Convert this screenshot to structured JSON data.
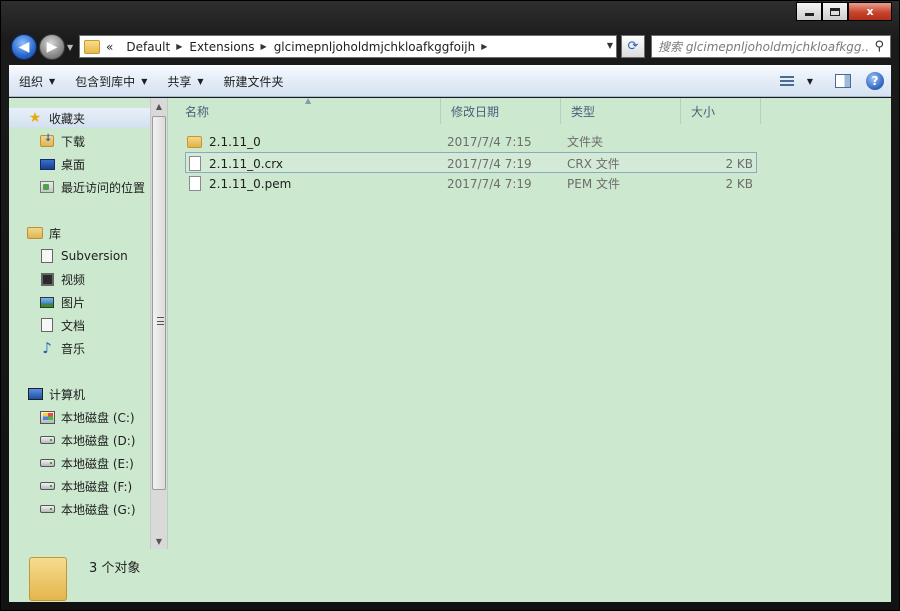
{
  "window": {
    "caption": {
      "minimize": "",
      "maximize": "",
      "close": "x"
    }
  },
  "address": {
    "prefix": "«",
    "crumbs": [
      "Default",
      "Extensions",
      "glcimepnljoholdmjchkloafkggfoijh"
    ],
    "separator": "▶"
  },
  "search": {
    "placeholder": "搜索 glcimepnljoholdmjchkloafkgg..."
  },
  "toolbar": {
    "organize": "组织",
    "include_in_library": "包含到库中",
    "share": "共享",
    "new_folder": "新建文件夹"
  },
  "navpane": {
    "favorites": {
      "label": "收藏夹",
      "items": [
        "下载",
        "桌面",
        "最近访问的位置"
      ]
    },
    "libraries": {
      "label": "库",
      "items": [
        "Subversion",
        "视频",
        "图片",
        "文档",
        "音乐"
      ]
    },
    "computer": {
      "label": "计算机",
      "items": [
        "本地磁盘 (C:)",
        "本地磁盘 (D:)",
        "本地磁盘 (E:)",
        "本地磁盘 (F:)",
        "本地磁盘 (G:)"
      ]
    }
  },
  "columns": {
    "name": "名称",
    "modified": "修改日期",
    "type": "类型",
    "size": "大小"
  },
  "files": [
    {
      "name": "2.1.11_0",
      "modified": "2017/7/4 7:15",
      "type": "文件夹",
      "size": "",
      "icon": "folder-icon"
    },
    {
      "name": "2.1.11_0.crx",
      "modified": "2017/7/4 7:19",
      "type": "CRX 文件",
      "size": "2 KB",
      "icon": "file-icon"
    },
    {
      "name": "2.1.11_0.pem",
      "modified": "2017/7/4 7:19",
      "type": "PEM 文件",
      "size": "2 KB",
      "icon": "file-icon"
    }
  ],
  "status": {
    "count": "3 个对象"
  },
  "colors": {
    "content_bg": "#cce8cf",
    "chrome": "#1a1a1a",
    "toolbar": "#dbe6f3",
    "close": "#c8442c"
  }
}
